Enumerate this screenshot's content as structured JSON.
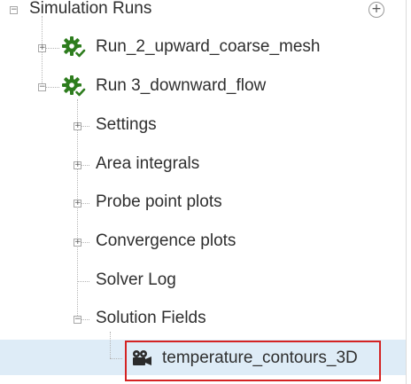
{
  "tree": {
    "root": {
      "label": "Simulation Runs",
      "toggle": "−",
      "add_button": "+"
    },
    "runs": [
      {
        "label": "Run_2_upward_coarse_mesh",
        "toggle": "+",
        "icon": "gear-check-icon"
      },
      {
        "label": "Run 3_downward_flow",
        "toggle": "−",
        "icon": "gear-check-icon",
        "children": [
          {
            "label": "Settings",
            "toggle": "+"
          },
          {
            "label": "Area integrals",
            "toggle": "+"
          },
          {
            "label": "Probe point plots",
            "toggle": "+"
          },
          {
            "label": "Convergence plots",
            "toggle": "+"
          },
          {
            "label": "Solver Log",
            "toggle": ""
          },
          {
            "label": "Solution Fields",
            "toggle": "−",
            "children": [
              {
                "label": "temperature_contours_3D",
                "icon": "video-camera-icon",
                "selected": true
              }
            ]
          }
        ]
      }
    ]
  },
  "colors": {
    "gear": "#2e7d1e",
    "check": "#2e7d1e",
    "selection_border": "#d42323",
    "selected_row": "#deecf7"
  }
}
